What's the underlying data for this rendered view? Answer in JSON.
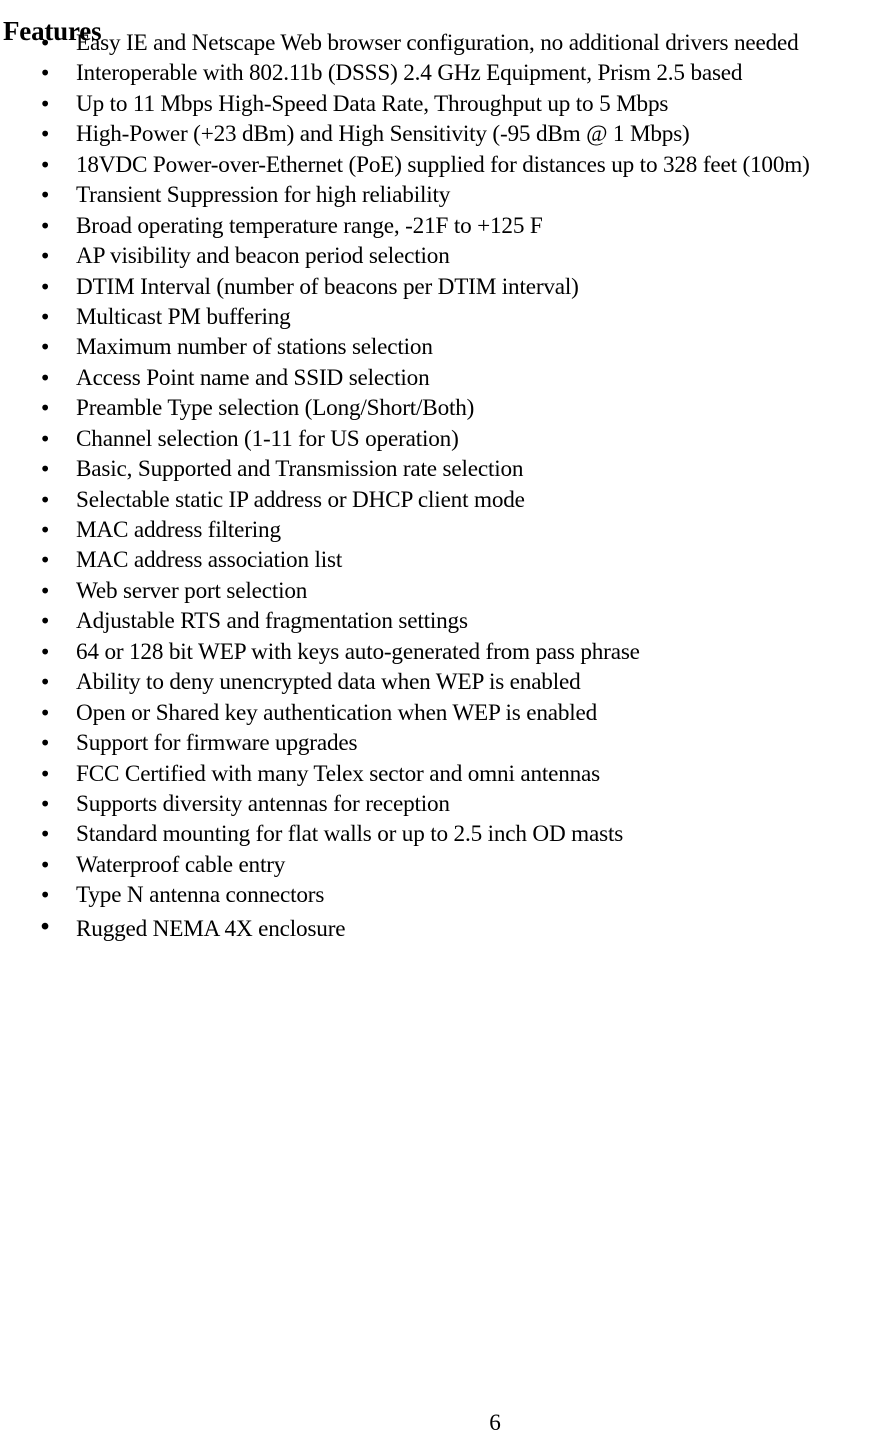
{
  "document": {
    "heading": "Features",
    "page_number": "6",
    "bullet_glyph": "•",
    "text_color": "#000000",
    "background_color": "#ffffff"
  },
  "features": [
    "Easy IE and Netscape Web browser configuration, no additional drivers needed",
    "Interoperable with 802.11b (DSSS) 2.4 GHz Equipment, Prism 2.5 based",
    "Up to 11 Mbps High-Speed Data Rate, Throughput up to 5 Mbps",
    "High-Power (+23 dBm) and High Sensitivity (-95 dBm @ 1 Mbps)",
    "18VDC Power-over-Ethernet (PoE) supplied for distances up to 328 feet (100m)",
    "Transient Suppression for high reliability",
    "Broad operating temperature range, -21F to +125 F",
    "AP visibility and beacon period selection",
    "DTIM Interval (number of beacons per DTIM interval)",
    "Multicast PM buffering",
    "Maximum number of stations selection",
    "Access Point name and SSID selection",
    "Preamble Type selection (Long/Short/Both)",
    "Channel selection (1-11 for US operation)",
    "Basic, Supported and Transmission rate selection",
    "Selectable static IP address or DHCP client mode",
    "MAC address filtering",
    "MAC address association list",
    "Web server port selection",
    "Adjustable RTS and fragmentation settings",
    "64 or 128 bit WEP with keys auto-generated from pass phrase",
    "Ability to deny unencrypted data when WEP is enabled",
    "Open or Shared key authentication when WEP is enabled",
    "Support for firmware upgrades",
    "FCC Certified with many Telex sector and omni antennas",
    "Supports diversity antennas for reception",
    "Standard mounting for flat walls or up to 2.5 inch OD masts",
    "Waterproof cable entry",
    "Type N antenna connectors",
    "Rugged NEMA 4X enclosure"
  ]
}
